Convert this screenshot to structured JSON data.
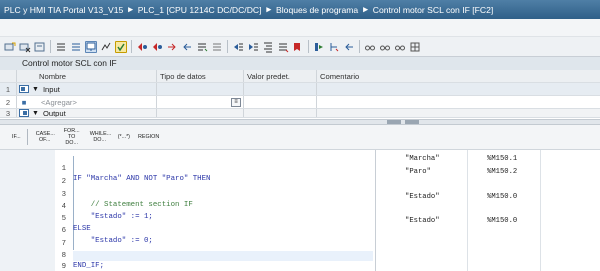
{
  "breadcrumb": {
    "project": "PLC y HMI TIA Portal V13_V15",
    "device": "PLC_1 [CPU 1214C DC/DC/DC]",
    "folder": "Bloques de programa",
    "block": "Control motor SCL con IF [FC2]",
    "separator": "▸"
  },
  "toolbar": {
    "icons": [
      "insert-network-icon",
      "delete-icon",
      "block-config-icon",
      "list-icon",
      "list-icon",
      "monitor-icon",
      "watch-icon",
      "go-online-icon",
      "compare-icon",
      "compare-icon",
      "jump-icon",
      "jump-icon",
      "bookmark-icon",
      "toggle-icon",
      "indent-icon",
      "indent-icon",
      "align-icon",
      "outdent-icon",
      "bookmark-icon",
      "comment-icon",
      "uncomment-icon",
      "glasses-icon",
      "glasses-icon",
      "glasses-icon",
      "grid-icon"
    ]
  },
  "interface": {
    "block_title": "Control motor SCL con IF",
    "columns": {
      "name": "Nombre",
      "type": "Tipo de datos",
      "default": "Valor predet.",
      "comment": "Comentario"
    },
    "rows": [
      {
        "num": "1",
        "name": "Input"
      },
      {
        "num": "2",
        "name": "<Agregar>"
      },
      {
        "num": "3",
        "name": "Output"
      }
    ]
  },
  "instructions": {
    "items": [
      "IF...",
      "CASE... OF...",
      "FOR... TO DO...",
      "WHILE... DO...",
      "(*...*)",
      "REGION"
    ]
  },
  "code": {
    "lines": [
      {
        "num": "1",
        "text": "IF \"Marcha\" AND NOT \"Paro\" THEN"
      },
      {
        "num": "2",
        "text": ""
      },
      {
        "num": "3",
        "text": "    // Statement section IF"
      },
      {
        "num": "4",
        "text": "    \"Estado\" := 1;"
      },
      {
        "num": "5",
        "text": "ELSE"
      },
      {
        "num": "6",
        "text": "    \"Estado\" := 0;"
      },
      {
        "num": "7",
        "text": ""
      },
      {
        "num": "8",
        "text": "END_IF;"
      },
      {
        "num": "9",
        "text": ""
      }
    ]
  },
  "references": [
    {
      "line": "1",
      "tag": "\"Marcha\"",
      "address": "%M150.1"
    },
    {
      "line": "2",
      "tag": "\"Paro\"",
      "address": "%M150.2"
    },
    {
      "line": "4",
      "tag": "\"Estado\"",
      "address": "%M150.0"
    },
    {
      "line": "6",
      "tag": "\"Estado\"",
      "address": "%M150.0"
    }
  ]
}
